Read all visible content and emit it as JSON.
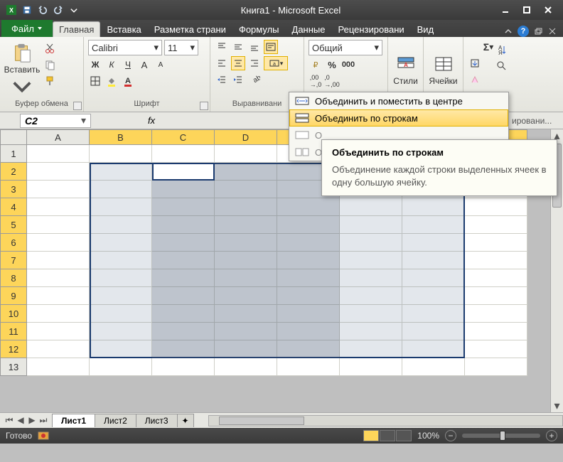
{
  "title": "Книга1 - Microsoft Excel",
  "tabs": {
    "file": "Файл",
    "items": [
      "Главная",
      "Вставка",
      "Разметка страни",
      "Формулы",
      "Данные",
      "Рецензировани",
      "Вид"
    ],
    "active": 0
  },
  "ribbon": {
    "clipboard": {
      "paste": "Вставить",
      "label": "Буфер обмена"
    },
    "font": {
      "name": "Calibri",
      "size": "11",
      "label": "Шрифт"
    },
    "alignment": {
      "label": "Выравнивани"
    },
    "number": {
      "format": "Общий"
    },
    "styles": {
      "label": "Стили"
    },
    "cells": {
      "label": "Ячейки"
    },
    "editing_cut": "ировани..."
  },
  "namebox": "C2",
  "fx": "fx",
  "columns": [
    "A",
    "B",
    "C",
    "D",
    "",
    "",
    "",
    ""
  ],
  "rows": [
    "1",
    "2",
    "3",
    "4",
    "5",
    "6",
    "7",
    "8",
    "9",
    "10",
    "11",
    "12",
    "13"
  ],
  "merge_menu": {
    "item1": "Объединить и поместить в центре",
    "item2": "Объединить по строкам",
    "item3_initial": "О",
    "item4_initial": "О"
  },
  "tooltip": {
    "title": "Объединить по строкам",
    "body": "Объединение каждой строки выделенных ячеек в одну большую ячейку."
  },
  "sheet_tabs": [
    "Лист1",
    "Лист2",
    "Лист3"
  ],
  "status": {
    "ready": "Готово",
    "zoom": "100%"
  }
}
